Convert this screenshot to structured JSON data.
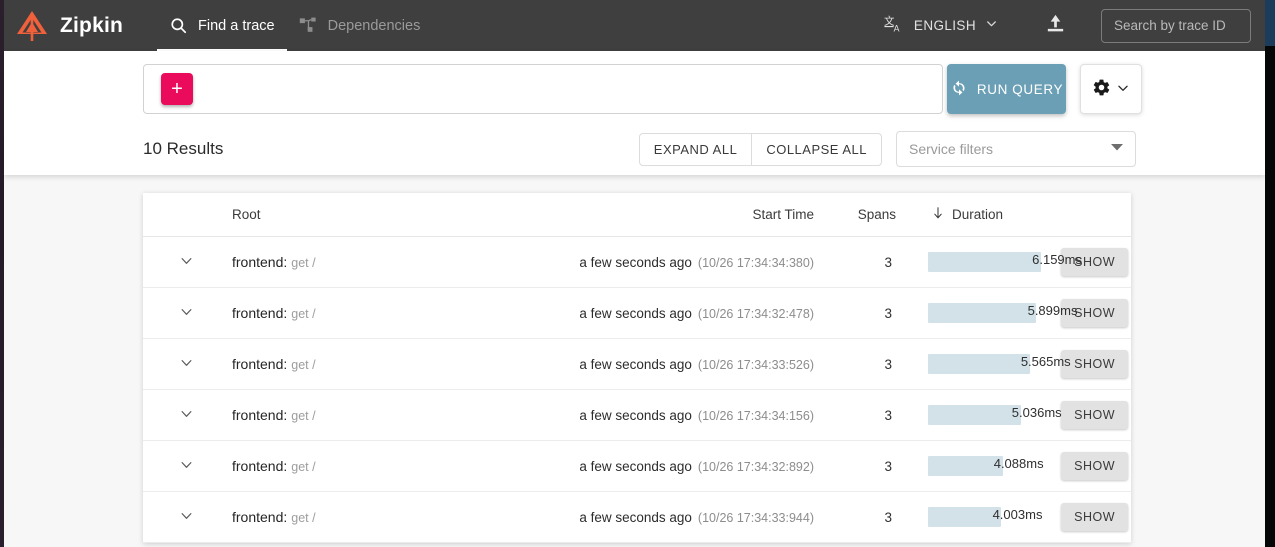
{
  "header": {
    "brand": "Zipkin",
    "logo_icon": "zipkin-logo-icon",
    "logo_color": "#f0603a",
    "tabs": [
      {
        "label": "Find a trace",
        "icon": "search-icon",
        "active": true
      },
      {
        "label": "Dependencies",
        "icon": "dependency-tree-icon",
        "active": false
      }
    ],
    "language": {
      "label": "ENGLISH",
      "icon": "translate-icon",
      "caret": "chevron-down-icon"
    },
    "upload_icon": "upload-icon",
    "trace_search_placeholder": "Search by trace ID",
    "trace_search_value": ""
  },
  "query": {
    "add_criterion_label": "+",
    "criteria_value": "",
    "run_query_label": "RUN QUERY",
    "run_query_icon": "refresh-icon",
    "run_query_color": "#6a9fb5",
    "add_button_color": "#ea0b5c",
    "settings_icon": "gear-icon",
    "settings_caret": "chevron-down-icon"
  },
  "results": {
    "count_label": "10 Results",
    "expand_all_label": "EXPAND ALL",
    "collapse_all_label": "COLLAPSE ALL",
    "service_filters_placeholder": "Service filters",
    "service_filters_caret": "caret-down-icon"
  },
  "table": {
    "columns": {
      "root": "Root",
      "start_time": "Start Time",
      "spans": "Spans",
      "duration": "Duration",
      "duration_sort_icon": "arrow-down-icon"
    },
    "bar_color": "#d3e2e9",
    "show_label": "SHOW",
    "row_caret_icon": "chevron-down-icon",
    "rows": [
      {
        "service": "frontend:",
        "operation": "get /",
        "start_relative": "a few seconds ago",
        "start_absolute": "(10/26 17:34:34:380)",
        "spans": "3",
        "duration": "6.159ms",
        "bar_pct": 100
      },
      {
        "service": "frontend:",
        "operation": "get /",
        "start_relative": "a few seconds ago",
        "start_absolute": "(10/26 17:34:32:478)",
        "spans": "3",
        "duration": "5.899ms",
        "bar_pct": 96
      },
      {
        "service": "frontend:",
        "operation": "get /",
        "start_relative": "a few seconds ago",
        "start_absolute": "(10/26 17:34:33:526)",
        "spans": "3",
        "duration": "5.565ms",
        "bar_pct": 90
      },
      {
        "service": "frontend:",
        "operation": "get /",
        "start_relative": "a few seconds ago",
        "start_absolute": "(10/26 17:34:34:156)",
        "spans": "3",
        "duration": "5.036ms",
        "bar_pct": 82
      },
      {
        "service": "frontend:",
        "operation": "get /",
        "start_relative": "a few seconds ago",
        "start_absolute": "(10/26 17:34:32:892)",
        "spans": "3",
        "duration": "4.088ms",
        "bar_pct": 66
      },
      {
        "service": "frontend:",
        "operation": "get /",
        "start_relative": "a few seconds ago",
        "start_absolute": "(10/26 17:34:33:944)",
        "spans": "3",
        "duration": "4.003ms",
        "bar_pct": 65
      }
    ]
  }
}
